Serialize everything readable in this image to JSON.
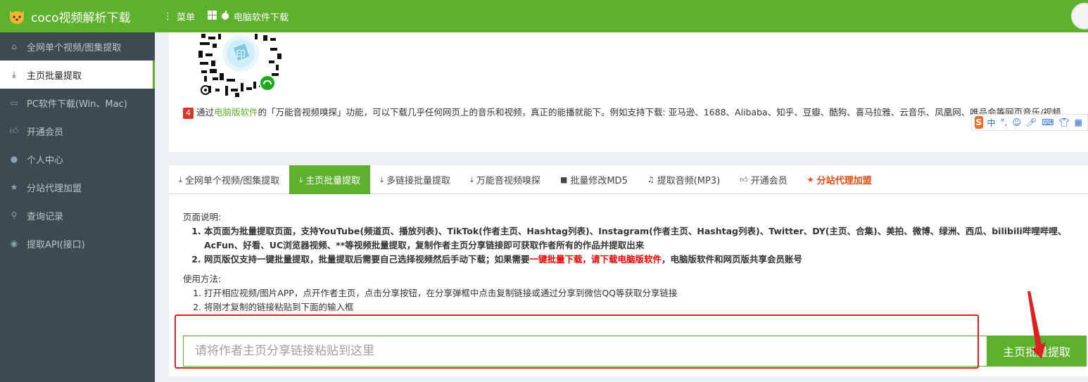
{
  "app": {
    "title": "coco视频解析下载"
  },
  "topnav": {
    "menu": "菜单",
    "pc_download": "电脑软件下载"
  },
  "sidebar": {
    "items": [
      {
        "label": "全网单个视频/图集提取",
        "icon": "home-icon"
      },
      {
        "label": "主页批量提取",
        "icon": "download-icon"
      },
      {
        "label": "PC软件下载(Win、Mac)",
        "icon": "desktop-icon"
      },
      {
        "label": "开通会员",
        "icon": "thumbs-up-icon"
      },
      {
        "label": "个人中心",
        "icon": "user-icon"
      },
      {
        "label": "分站代理加盟",
        "icon": "star-icon"
      },
      {
        "label": "查询记录",
        "icon": "search-icon"
      },
      {
        "label": "提取API(接口)",
        "icon": "github-icon"
      }
    ]
  },
  "top_card": {
    "step_number": "4",
    "step_pre": "通过",
    "step_link": "电脑版软件",
    "step_post": "的「万能音视频嗅探」功能，可以下载几乎任何网页上的音乐和视频，真正的能播就能下。例如支持下载: 亚马逊、1688、Alibaba、知乎、豆瓣、酷狗、喜马拉雅、云音乐、凤凰网、唯品会等网页音乐/视频"
  },
  "ime": {
    "lang": "中"
  },
  "tabs": [
    {
      "label": "全网单个视频/图集提取"
    },
    {
      "label": "主页批量提取"
    },
    {
      "label": "多链接批量提取"
    },
    {
      "label": "万能音视频嗅探"
    },
    {
      "label": "批量修改MD5"
    },
    {
      "label": "提取音频(MP3)"
    },
    {
      "label": "开通会员"
    },
    {
      "label": "分站代理加盟"
    }
  ],
  "page_desc": {
    "heading": "页面说明:",
    "item1": "本页面为批量提取页面，支持YouTube(频道页、播放列表)、TikTok(作者主页、Hashtag列表)、Instagram(作者主页、Hashtag列表)、Twitter、DY(主页、合集)、美拍、微博、绿洲、西瓜、bilibili哔哩哔哩、AcFun、好看、UC浏览器视频、**等视频批量提取，复制作者主页分享链接即可获取作者所有的作品并提取出来",
    "item2_pre": "网页版仅支持一键批量提取，批量提取后需要自己选择视频然后手动下载；如果需要",
    "item2_red": "一键批量下载",
    "item2_mid": "，请下载电脑版软件",
    "item2_post": "，电脑版软件和网页版共享会员账号"
  },
  "usage": {
    "heading": "使用方法:",
    "item1": "打开相应视频/图片APP，点开作者主页，点击分享按钮，在分享弹框中点击复制链接或通过分享到微信QQ等获取分享链接",
    "item2": "将刚才复制的链接粘贴到下面的输入框"
  },
  "search": {
    "placeholder": "请将作者主页分享链接粘贴到这里",
    "button": "主页批量提取"
  },
  "colors": {
    "brand": "#5db12d",
    "sidebar": "#3d4a52",
    "annotation": "#e02020"
  }
}
